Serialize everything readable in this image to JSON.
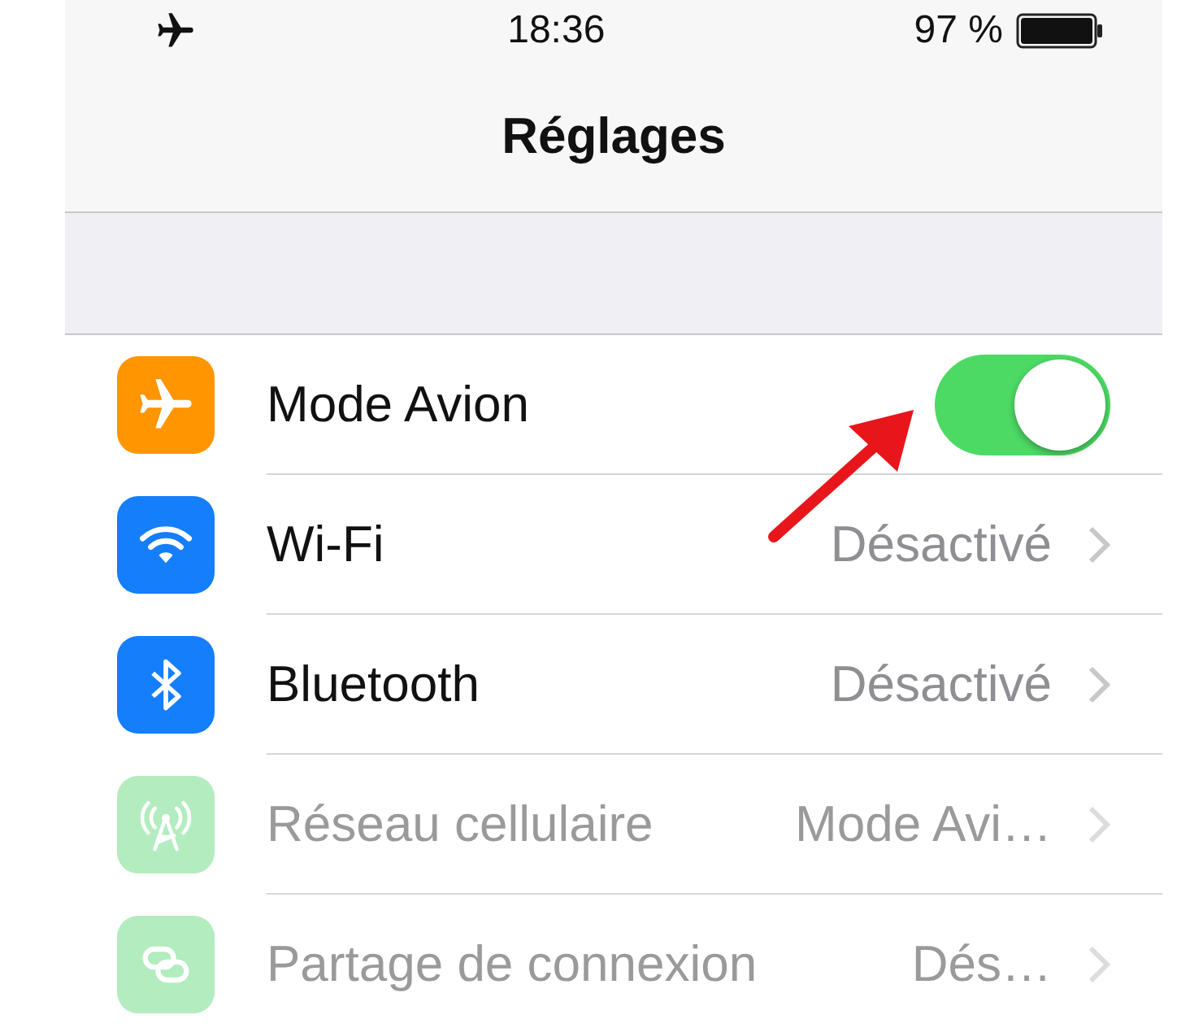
{
  "status_bar": {
    "time": "18:36",
    "battery": "97 %"
  },
  "title": "Réglages",
  "rows": [
    {
      "kind": "toggle",
      "label": "Mode Avion",
      "color": "#ff9500",
      "on": true,
      "disabled": false
    },
    {
      "kind": "link",
      "label": "Wi-Fi",
      "value": "Désactivé",
      "color": "#147efb",
      "disabled": false
    },
    {
      "kind": "link",
      "label": "Bluetooth",
      "value": "Désactivé",
      "color": "#147efb",
      "disabled": false
    },
    {
      "kind": "link",
      "label": "Réseau cellulaire",
      "value": "Mode Avi…",
      "color": "#b3ecbf",
      "disabled": true
    },
    {
      "kind": "link",
      "label": "Partage de connexion",
      "value": "Dés…",
      "color": "#b3ecbf",
      "disabled": true
    }
  ]
}
